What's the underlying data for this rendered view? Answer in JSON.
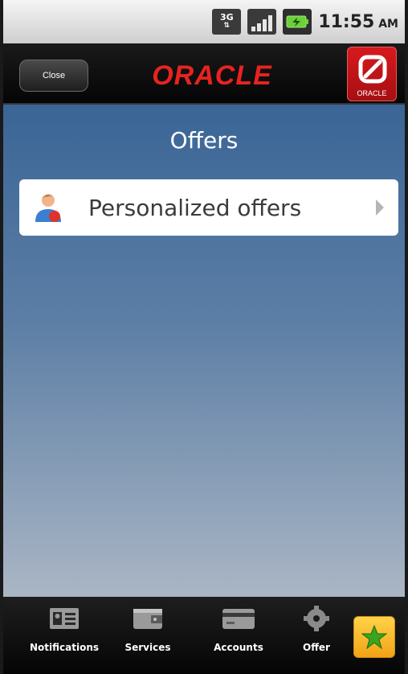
{
  "status_bar": {
    "network": "3G",
    "time": "11:55",
    "ampm": "AM"
  },
  "header": {
    "close_label": "Close",
    "logo_text": "ORACLE",
    "app_icon_text": "ORACLE"
  },
  "main": {
    "title": "Offers",
    "items": [
      {
        "label": "Personalized offers",
        "icon": "person-icon"
      }
    ]
  },
  "tabbar": {
    "tabs": [
      {
        "label": "Notifications",
        "icon": "contact-card-icon"
      },
      {
        "label": "Services",
        "icon": "wallet-icon"
      },
      {
        "label": "Accounts",
        "icon": "credit-card-icon"
      },
      {
        "label": "Offer",
        "icon": "gear-icon"
      }
    ],
    "favorite_icon": "star-icon"
  },
  "colors": {
    "oracle_red": "#e8231f",
    "header_bg": "#0c0c0c",
    "main_gradient_top": "#3a6596",
    "main_gradient_bottom": "#aab6c4"
  }
}
